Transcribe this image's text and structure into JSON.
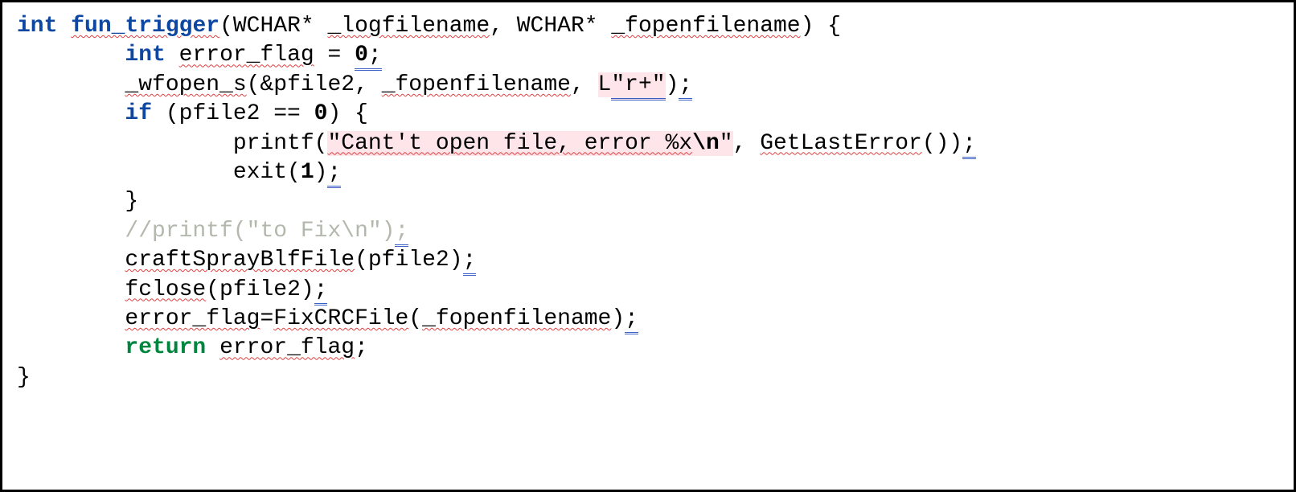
{
  "code": {
    "l1": {
      "kw_type": "int",
      "func": "fun_trigger",
      "open": "(WCHAR* ",
      "p1": "_logfilename",
      "mid": ", WCHAR* ",
      "p2": "_fopenfilename",
      "close": ") {"
    },
    "l2": {
      "indent": "        ",
      "kw_type": "int",
      "sp": " ",
      "var": "error_flag",
      "assign": " = ",
      "val": "0",
      "semi": ";"
    },
    "l3": {
      "indent": "        ",
      "fn": "_wfopen_s",
      "args1": "(&pfile2, ",
      "arg2": "_fopenfilename",
      "args3": ", ",
      "lit_pre": "L",
      "lit": "\"r+\"",
      "close": ")",
      "semi": ";"
    },
    "l4": {
      "indent": "        ",
      "kw": "if",
      "cond": " (pfile2 == ",
      "zero": "0",
      "close": ") {"
    },
    "l5": {
      "indent": "                ",
      "fn": "printf(",
      "str1": "\"Cant't open file, error %x",
      "esc": "\\n",
      "str2": "\"",
      "post": ", ",
      "call": "GetLastError",
      "close": "())",
      "semi": ";"
    },
    "l6": {
      "indent": "                ",
      "fn": "exit(",
      "arg": "1",
      "close": ")",
      "semi": ";"
    },
    "l7": {
      "indent": "        ",
      "brace": "}"
    },
    "l8": {
      "indent": "        ",
      "comment_body": "//printf(\"to Fix\\n\")",
      "semi": ";"
    },
    "l9": {
      "indent": "        ",
      "fn": "craftSprayBlfFile",
      "args": "(pfile2)",
      "semi": ";"
    },
    "l10": {
      "indent": "        ",
      "fn": "fclose",
      "args": "(pfile2)",
      "semi": ";"
    },
    "l11": {
      "indent": "        ",
      "lhs": "error_flag",
      "eq": "=",
      "fn": "FixCRCFile",
      "open": "(",
      "arg": "_fopenfilename",
      "close": ")",
      "semi": ";"
    },
    "l12": {
      "indent": "        ",
      "kw": "return",
      "sp": " ",
      "var": "error_flag",
      "semi": ";"
    },
    "l13": {
      "brace": "}"
    }
  }
}
